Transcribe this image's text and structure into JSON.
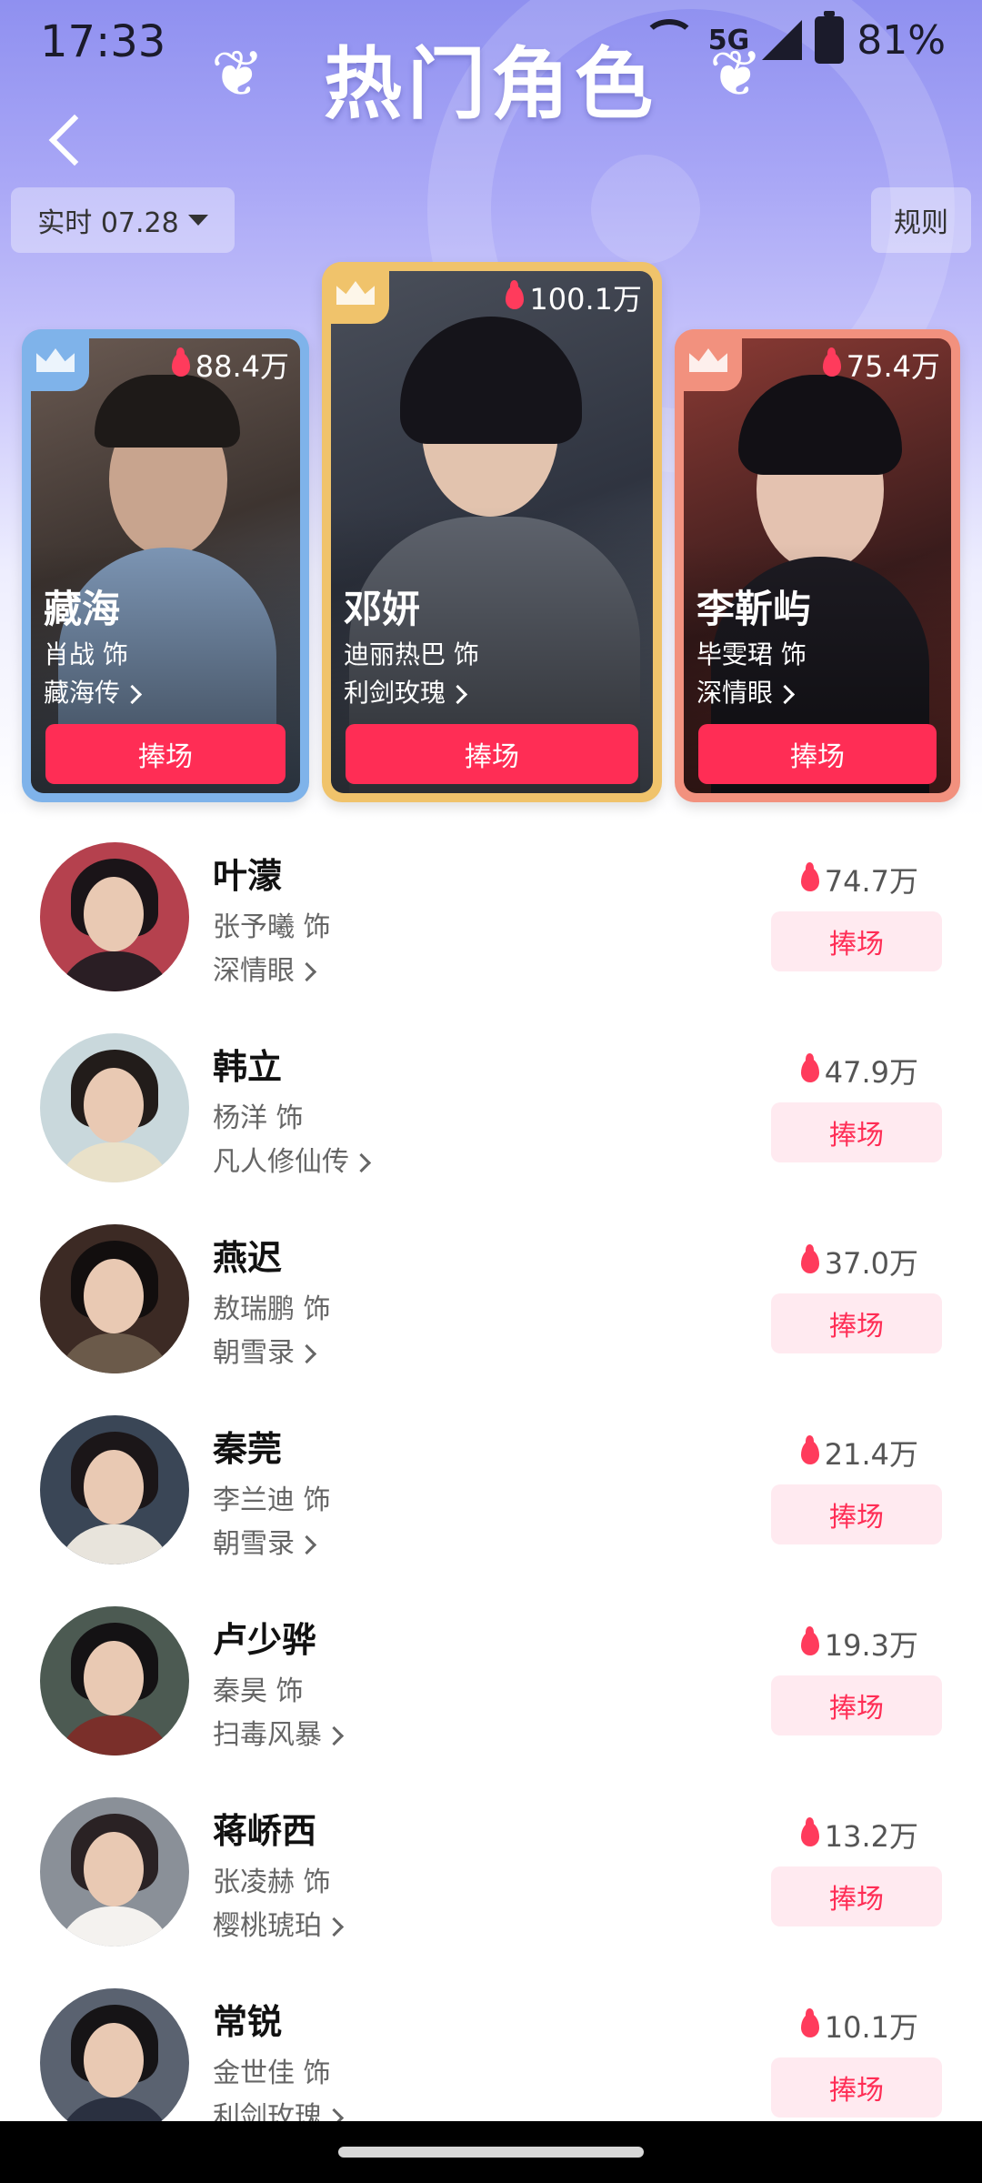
{
  "status_bar": {
    "time": "17:33",
    "network": "5G",
    "battery": "81%"
  },
  "header": {
    "title": "热门角色",
    "date_filter": "实时 07.28",
    "rules": "规则"
  },
  "top_cards": [
    {
      "rank": 2,
      "heat": "88.4万",
      "character": "藏海",
      "actor": "肖战 饰",
      "show": "藏海传",
      "button": "捧场",
      "accent": "#7fb3ea"
    },
    {
      "rank": 1,
      "heat": "100.1万",
      "character": "邓妍",
      "actor": "迪丽热巴 饰",
      "show": "利剑玫瑰",
      "button": "捧场",
      "accent": "#f0c36b"
    },
    {
      "rank": 3,
      "heat": "75.4万",
      "character": "李靳屿",
      "actor": "毕雯珺 饰",
      "show": "深情眼",
      "button": "捧场",
      "accent": "#f2917e"
    }
  ],
  "list": [
    {
      "character": "叶濛",
      "actor": "张予曦 饰",
      "show": "深情眼",
      "heat": "74.7万",
      "button": "捧场"
    },
    {
      "character": "韩立",
      "actor": "杨洋 饰",
      "show": "凡人修仙传",
      "heat": "47.9万",
      "button": "捧场"
    },
    {
      "character": "燕迟",
      "actor": "敖瑞鹏 饰",
      "show": "朝雪录",
      "heat": "37.0万",
      "button": "捧场"
    },
    {
      "character": "秦莞",
      "actor": "李兰迪 饰",
      "show": "朝雪录",
      "heat": "21.4万",
      "button": "捧场"
    },
    {
      "character": "卢少骅",
      "actor": "秦昊 饰",
      "show": "扫毒风暴",
      "heat": "19.3万",
      "button": "捧场"
    },
    {
      "character": "蒋峤西",
      "actor": "张凌赫 饰",
      "show": "樱桃琥珀",
      "heat": "13.2万",
      "button": "捧场"
    },
    {
      "character": "常锐",
      "actor": "金世佳 饰",
      "show": "利剑玫瑰",
      "heat": "10.1万",
      "button": "捧场"
    }
  ]
}
